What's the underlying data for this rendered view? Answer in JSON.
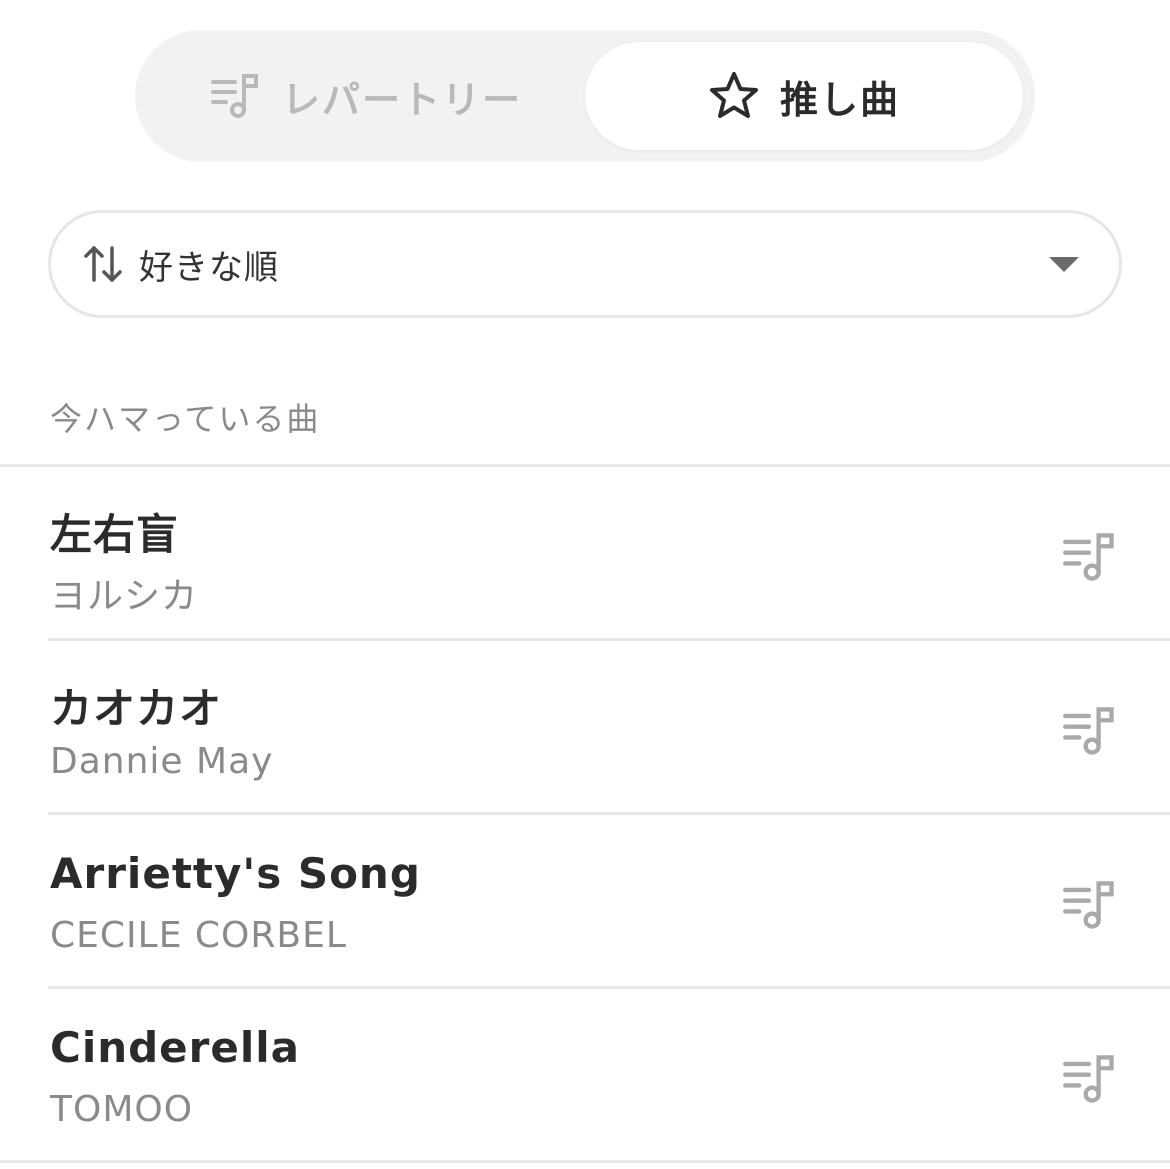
{
  "tabs": {
    "repertoire": {
      "label": "レパートリー",
      "icon": "music-list-icon",
      "active": false
    },
    "favorites": {
      "label": "推し曲",
      "icon": "star-icon",
      "active": true
    }
  },
  "sort": {
    "label": "好きな順",
    "icon": "sort-arrows-icon"
  },
  "section": {
    "title": "今ハマっている曲"
  },
  "songs": [
    {
      "title": "左右盲",
      "artist": "ヨルシカ"
    },
    {
      "title": "カオカオ",
      "artist": "Dannie May"
    },
    {
      "title": "Arrietty's Song",
      "artist": "CECILE CORBEL"
    },
    {
      "title": "Cinderella",
      "artist": "TOMOO"
    }
  ],
  "colors": {
    "active_text": "#2b2b2b",
    "inactive_text": "#b9b9b9",
    "secondary_text": "#8a8a8a",
    "divider": "#e8e8e8",
    "segment_bg": "#f2f2f2"
  }
}
